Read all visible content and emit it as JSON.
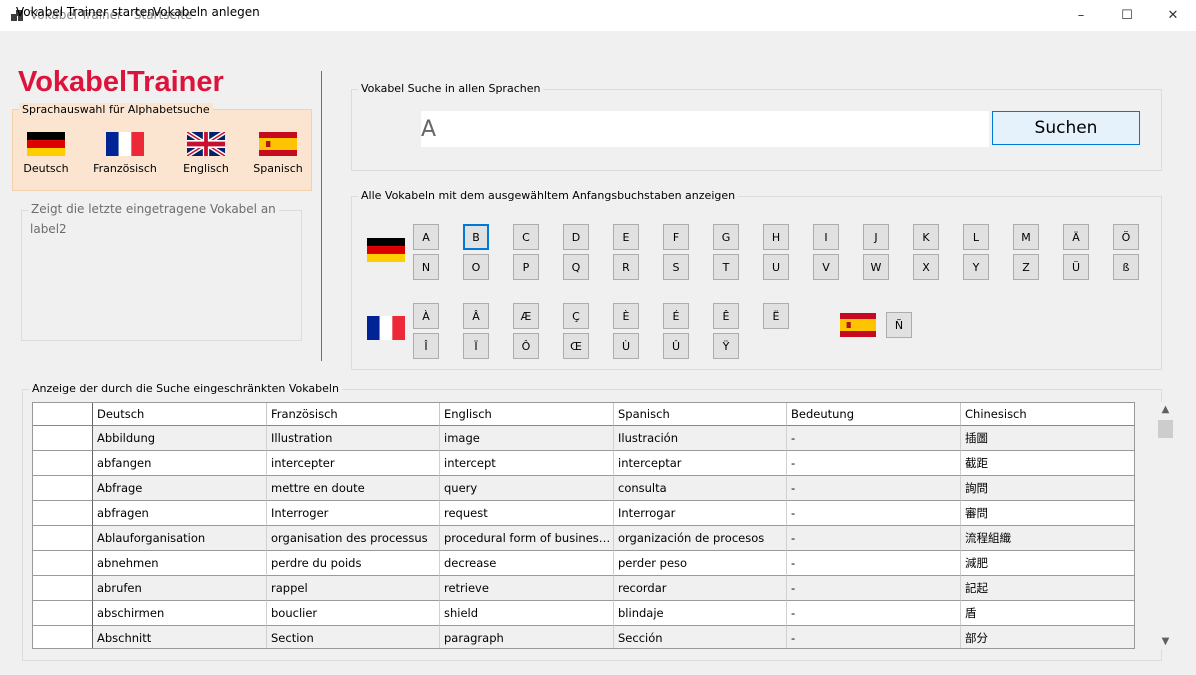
{
  "window": {
    "title": "Vokabel Trainer - Startseite",
    "controls": {
      "minimize": "–",
      "maximize": "☐",
      "close": "✕"
    }
  },
  "menu": [
    "Vokabel Trainer starten",
    "Vokabeln anlegen"
  ],
  "app_title": "VokabelTrainer",
  "language_select": {
    "label": "Sprachauswahl für Alphabetsuche",
    "languages": [
      {
        "name": "Deutsch",
        "flag": "de"
      },
      {
        "name": "Französisch",
        "flag": "fr"
      },
      {
        "name": "Englisch",
        "flag": "gb"
      },
      {
        "name": "Spanisch",
        "flag": "es"
      }
    ]
  },
  "last_vocab": {
    "label": "Zeigt die letzte eingetragene Vokabel an",
    "value": "label2"
  },
  "search": {
    "label": "Vokabel Suche in allen Sprachen",
    "value": "A",
    "button": "Suchen"
  },
  "alphabet": {
    "label": "Alle Vokabeln mit dem ausgewähltem Anfangsbuchstaben anzeigen",
    "german_row1": [
      "A",
      "B",
      "C",
      "D",
      "E",
      "F",
      "G",
      "H",
      "I",
      "J",
      "K",
      "L",
      "M",
      "Ä",
      "Ö"
    ],
    "german_row2": [
      "N",
      "O",
      "P",
      "Q",
      "R",
      "S",
      "T",
      "U",
      "V",
      "W",
      "X",
      "Y",
      "Z",
      "Ü",
      "ß"
    ],
    "french_row1": [
      "À",
      "Â",
      "Æ",
      "Ç",
      "È",
      "É",
      "Ê",
      "Ë"
    ],
    "french_row2": [
      "Î",
      "Ï",
      "Ô",
      "Œ",
      "Ù",
      "Û",
      "Ÿ"
    ],
    "spanish": [
      "Ñ"
    ],
    "focused": "B"
  },
  "table": {
    "label": "Anzeige der durch die Suche eingeschränkten Vokabeln",
    "columns": [
      "Deutsch",
      "Französisch",
      "Englisch",
      "Spanisch",
      "Bedeutung",
      "Chinesisch"
    ],
    "rows": [
      [
        "Abbildung",
        "Illustration",
        "image",
        "Ilustración",
        "-",
        "插圖"
      ],
      [
        "abfangen",
        "intercepter",
        "intercept",
        "interceptar",
        "-",
        "截距"
      ],
      [
        "Abfrage",
        "mettre en doute",
        "query",
        "consulta",
        "-",
        "詢問"
      ],
      [
        "abfragen",
        "Interroger",
        "request",
        "Interrogar",
        "-",
        "審問"
      ],
      [
        "Ablauforganisation",
        "organisation des processus",
        "procedural form of business o...",
        "organización de procesos",
        "-",
        "流程組織"
      ],
      [
        "abnehmen",
        "perdre du poids",
        "decrease",
        "perder peso",
        "-",
        "減肥"
      ],
      [
        "abrufen",
        "rappel",
        "retrieve",
        "recordar",
        "-",
        "記起"
      ],
      [
        "abschirmen",
        "bouclier",
        "shield",
        "blindaje",
        "-",
        "盾"
      ],
      [
        "Abschnitt",
        "Section",
        "paragraph",
        "Sección",
        "-",
        "部分"
      ]
    ]
  },
  "colors": {
    "accent": "#dc143c",
    "lang_bg": "#fbe5d0",
    "focus": "#0078d7"
  }
}
